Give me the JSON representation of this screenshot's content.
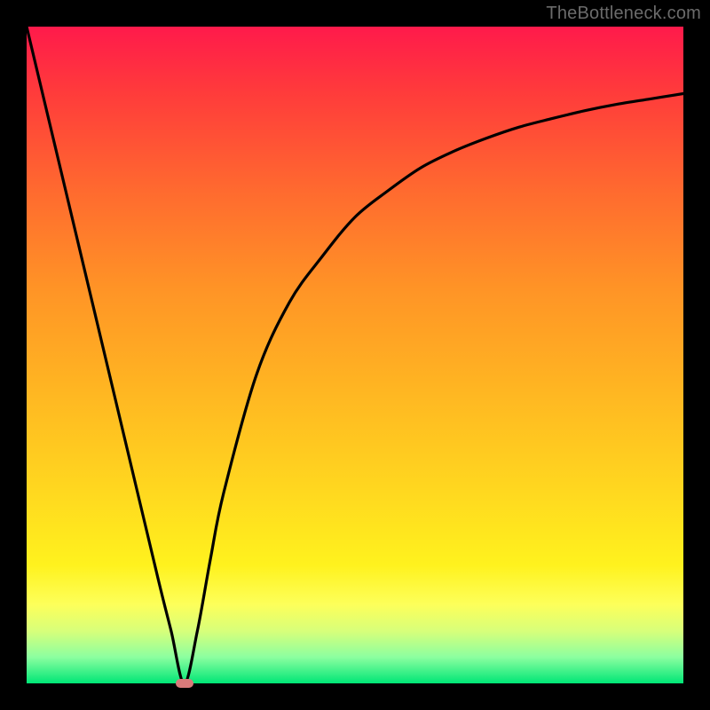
{
  "watermark": "TheBottleneck.com",
  "colors": {
    "frame_bg": "#000000",
    "gradient_top": "#ff1a4b",
    "gradient_bottom": "#00e676",
    "curve": "#000000",
    "marker": "#d97a7a",
    "watermark": "#6b6b6b"
  },
  "chart_data": {
    "type": "line",
    "title": "",
    "xlabel": "",
    "ylabel": "",
    "xlim": [
      0,
      100
    ],
    "ylim": [
      0,
      100
    ],
    "series": [
      {
        "name": "bottleneck-curve",
        "x": [
          0,
          5,
          10,
          15,
          20,
          22,
          24,
          26,
          28,
          30,
          35,
          40,
          45,
          50,
          55,
          60,
          65,
          70,
          75,
          80,
          85,
          90,
          95,
          100
        ],
        "y": [
          100,
          79,
          58,
          37,
          16,
          8,
          0,
          8,
          19,
          29,
          47,
          58,
          65,
          71,
          75,
          78.5,
          81,
          83,
          84.7,
          86,
          87.2,
          88.2,
          89,
          89.8
        ]
      }
    ],
    "marker": {
      "x": 24,
      "y": 0,
      "shape": "pill"
    },
    "background": "vertical-gradient-red-to-green"
  }
}
